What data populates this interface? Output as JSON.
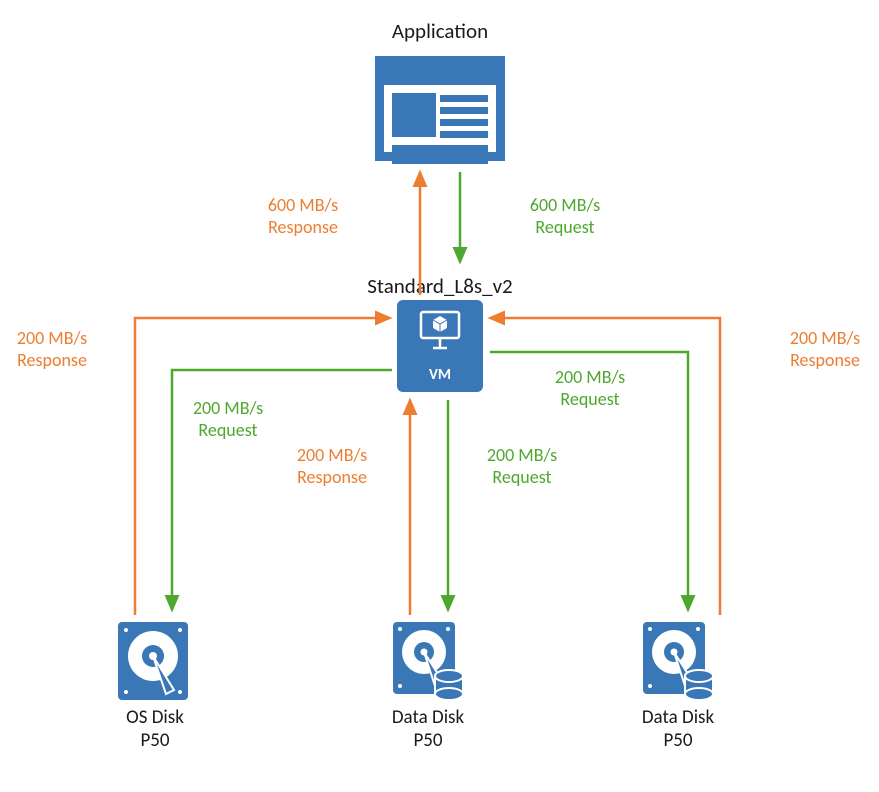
{
  "titles": {
    "application": "Application",
    "vm": "Standard_L8s_v2"
  },
  "vm": {
    "label": "VM"
  },
  "flows": {
    "app_response": {
      "line1": "600 MB/s",
      "line2": "Response"
    },
    "app_request": {
      "line1": "600 MB/s",
      "line2": "Request"
    },
    "os_response": {
      "line1": "200 MB/s",
      "line2": "Response"
    },
    "d2_response": {
      "line1": "200 MB/s",
      "line2": "Response"
    },
    "os_request": {
      "line1": "200 MB/s",
      "line2": "Request"
    },
    "d1_request_upper": {
      "line1": "200 MB/s",
      "line2": "Request"
    },
    "d1_response": {
      "line1": "200 MB/s",
      "line2": "Response"
    },
    "d1_request_lower": {
      "line1": "200 MB/s",
      "line2": "Request"
    }
  },
  "disks": {
    "os": {
      "line1": "OS Disk",
      "line2": "P50"
    },
    "d1": {
      "line1": "Data Disk",
      "line2": "P50"
    },
    "d2": {
      "line1": "Data Disk",
      "line2": "P50"
    }
  },
  "colors": {
    "primary": "#3A77B7",
    "orange": "#ED7D31",
    "green": "#4EA72E"
  }
}
